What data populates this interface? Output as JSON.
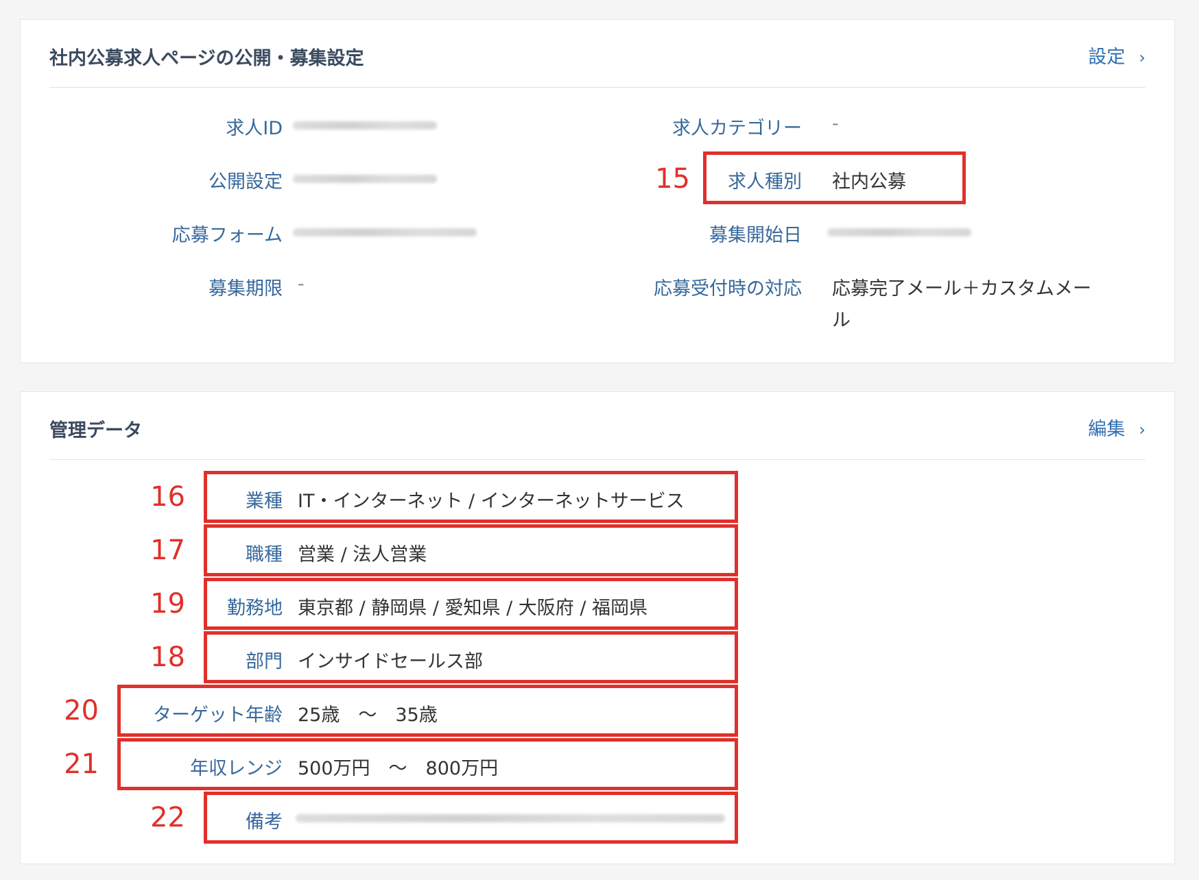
{
  "publish": {
    "title": "社内公募求人ページの公開・募集設定",
    "link_label": "設定",
    "chevron": "›",
    "fields": {
      "job_id": {
        "label": "求人ID"
      },
      "publish_setting": {
        "label": "公開設定"
      },
      "application_form": {
        "label": "応募フォーム"
      },
      "deadline": {
        "label": "募集期限",
        "value": "-"
      },
      "category": {
        "label": "求人カテゴリー",
        "value": "-"
      },
      "job_type": {
        "label": "求人種別",
        "value": "社内公募",
        "annotation": "15"
      },
      "start_date": {
        "label": "募集開始日"
      },
      "response": {
        "label": "応募受付時の対応",
        "value_line1": "応募完了メール＋カスタムメー",
        "value_line2": "ル"
      }
    }
  },
  "management": {
    "title": "管理データ",
    "link_label": "編集",
    "chevron": "›",
    "rows": [
      {
        "label": "業種",
        "value": "IT・インターネット / インターネットサービス",
        "annotation": "16"
      },
      {
        "label": "職種",
        "value": "営業 / 法人営業",
        "annotation": "17"
      },
      {
        "label": "勤務地",
        "value": "東京都 / 静岡県 / 愛知県 / 大阪府 / 福岡県",
        "annotation": "19"
      },
      {
        "label": "部門",
        "value": "インサイドセールス部",
        "annotation": "18"
      },
      {
        "label": "ターゲット年齢",
        "value": "25歳　～　35歳",
        "annotation": "20"
      },
      {
        "label": "年収レンジ",
        "value": "500万円　～　800万円",
        "annotation": "21"
      },
      {
        "label": "備考",
        "annotation": "22"
      }
    ]
  },
  "colors": {
    "label": "#37689b",
    "link": "#2f6fb3",
    "annotation": "#e0302b",
    "title": "#3b4a5e"
  }
}
